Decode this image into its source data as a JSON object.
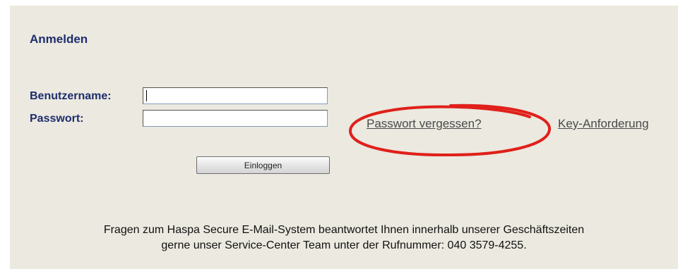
{
  "login": {
    "title": "Anmelden",
    "username_label": "Benutzername:",
    "password_label": "Passwort:",
    "username_value": "",
    "password_value": "",
    "submit_label": "Einloggen"
  },
  "links": {
    "forgot_password": "Passwort vergessen?",
    "key_request": "Key-Anforderung"
  },
  "footer": {
    "line1": "Fragen zum Haspa Secure E-Mail-System beantwortet Ihnen innerhalb unserer Geschäftszeiten",
    "line2": "gerne unser Service-Center Team unter der Rufnummer: 040 3579-4255."
  },
  "colors": {
    "label": "#1e2d6b",
    "panel": "#ebe9e0",
    "annotation": "#e0201a"
  }
}
